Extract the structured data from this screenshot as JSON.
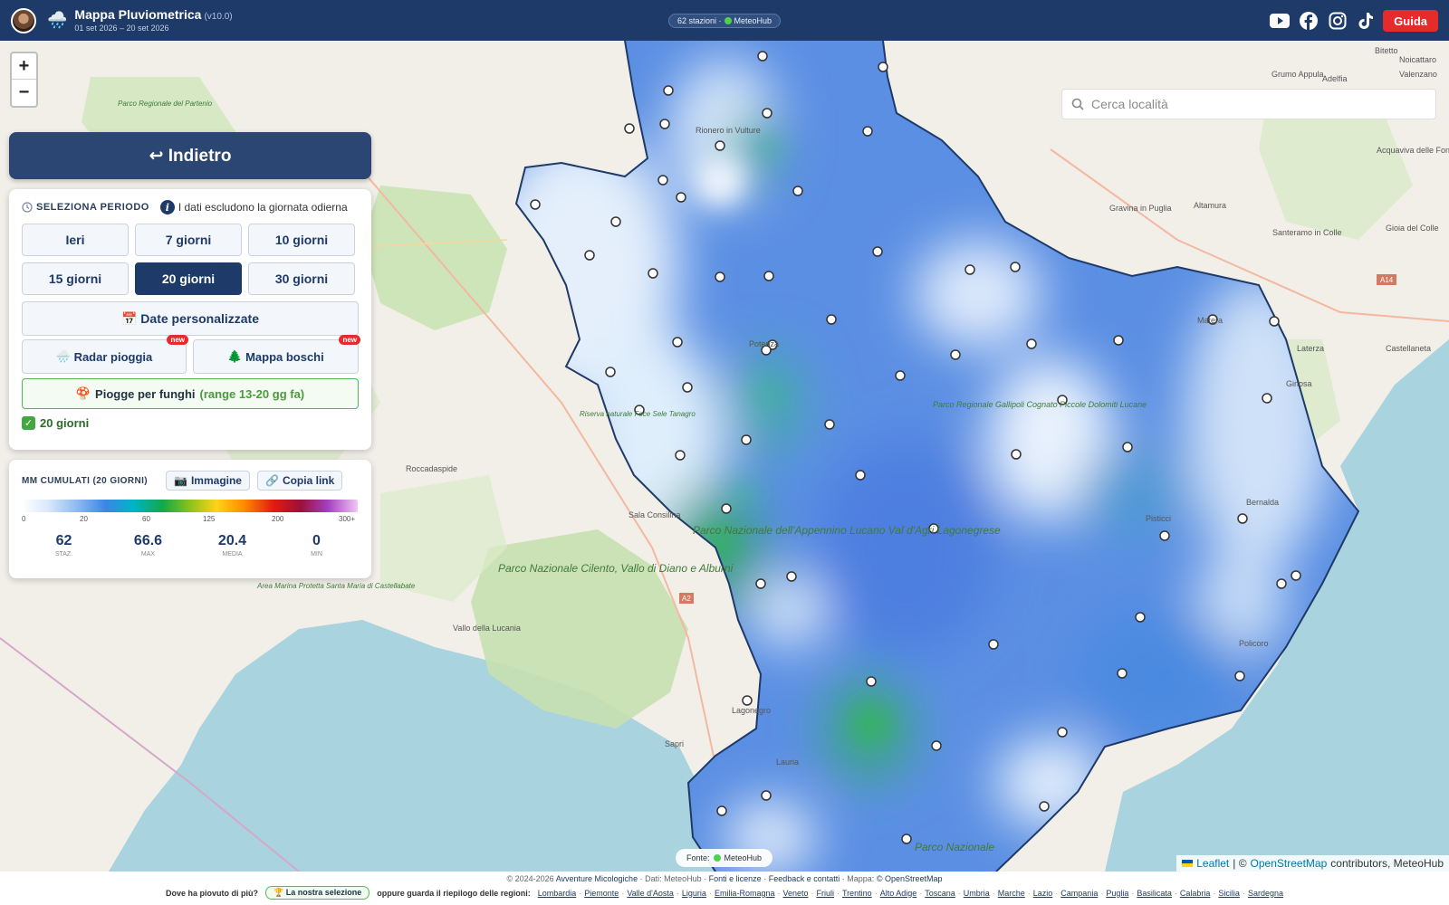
{
  "header": {
    "title": "Mappa Pluviometrica",
    "version": "(v10.0)",
    "date_range": "01 set 2026 – 20 set 2026",
    "station_pill": "62 stazioni · ",
    "station_source": "MeteoHub",
    "guide_label": "Guida",
    "social": [
      "youtube-icon",
      "facebook-icon",
      "instagram-icon",
      "tiktok-icon"
    ]
  },
  "map": {
    "zoom_in": "+",
    "zoom_out": "−",
    "search_placeholder": "Cerca località",
    "source_label": "Fonte:",
    "source_name": "MeteoHub",
    "attribution_leaflet": "Leaflet",
    "attribution_sep": "| ©",
    "attribution_osm": "OpenStreetMap",
    "attribution_tail": "contributors, MeteoHub",
    "place_labels": [
      "Rionero in Vulture",
      "Gravina in Puglia",
      "Altamura",
      "Gioia del Colle",
      "Acquaviva delle Fonti",
      "Grumo Appula",
      "Bitetto",
      "Valenzano",
      "Noicattaro",
      "Adelfia",
      "Santeramo in Colle",
      "Matera",
      "Laterza",
      "Castellaneta",
      "Ginosa",
      "Potenza",
      "Sala Consilina",
      "Roccadaspide",
      "Vallo della Lucania",
      "Pisticci",
      "Policoro",
      "Bernalda",
      "Lauria",
      "Sapri",
      "Lagonegro",
      "Parco Nazionale Cilento, Vallo di Diano e Alburni",
      "Parco Nazionale dell'Appennino Lucano Val d'Agri Lagonegrese",
      "Parco Regionale Gallipoli Cognato Piccole Dolomiti Lucane",
      "Parco Nazionale",
      "Area Marina Protetta Santa Maria di Castellabate",
      "Riserva naturale Foce Sele Tanagro",
      "Parco Regionale del Partenio",
      "A14",
      "A2"
    ]
  },
  "back_button": {
    "label": "↩ Indietro"
  },
  "period": {
    "title": "SELEZIONA PERIODO",
    "info_icon": "i",
    "info_text": "I dati escludono la giornata odierna",
    "buttons": [
      "Ieri",
      "7 giorni",
      "10 giorni",
      "15 giorni",
      "20 giorni",
      "30 giorni"
    ],
    "active": "20 giorni",
    "custom_dates": "Date personalizzate",
    "radar": "Radar pioggia",
    "woods": "Mappa boschi",
    "new_badge": "new",
    "fungi_label": "Piogge per funghi",
    "fungi_range": "(range 13-20 gg fa)",
    "selected_label": "20 giorni"
  },
  "legend": {
    "title": "MM CUMULATI (20 GIORNI)",
    "image_button": "Immagine",
    "link_button": "Copia link",
    "ticks": [
      "0",
      "20",
      "60",
      "125",
      "200",
      "300+"
    ],
    "stats": [
      {
        "value": "62",
        "key": "STAZ."
      },
      {
        "value": "66.6",
        "key": "MAX"
      },
      {
        "value": "20.4",
        "key": "MEDIA"
      },
      {
        "value": "0",
        "key": "MIN"
      }
    ]
  },
  "footer": {
    "copyright": "© 2024-2026",
    "site": "Avventure Micologiche",
    "data_text": "· Dati: MeteoHub ·",
    "licenses": "Fonti e licenze",
    "dot": "·",
    "feedback": "Feedback e contatti",
    "map_text": "· Mappa:",
    "osm": "© OpenStreetMap",
    "question": "Dove ha piovuto di più?",
    "selection": "🏆 La nostra selezione",
    "regions_intro": "oppure guarda il riepilogo delle regioni:",
    "regions": [
      "Lombardia",
      "Piemonte",
      "Valle d'Aosta",
      "Liguria",
      "Emilia-Romagna",
      "Veneto",
      "Friuli",
      "Trentino",
      "Alto Adige",
      "Toscana",
      "Umbria",
      "Marche",
      "Lazio",
      "Campania",
      "Puglia",
      "Basilicata",
      "Calabria",
      "Sicilia",
      "Sardegna"
    ]
  },
  "colors": {
    "header_bg": "#1e3a68",
    "accent_red": "#e52b2b",
    "active_blue": "#1e3a68",
    "fungi_green": "#4a9b3c"
  }
}
